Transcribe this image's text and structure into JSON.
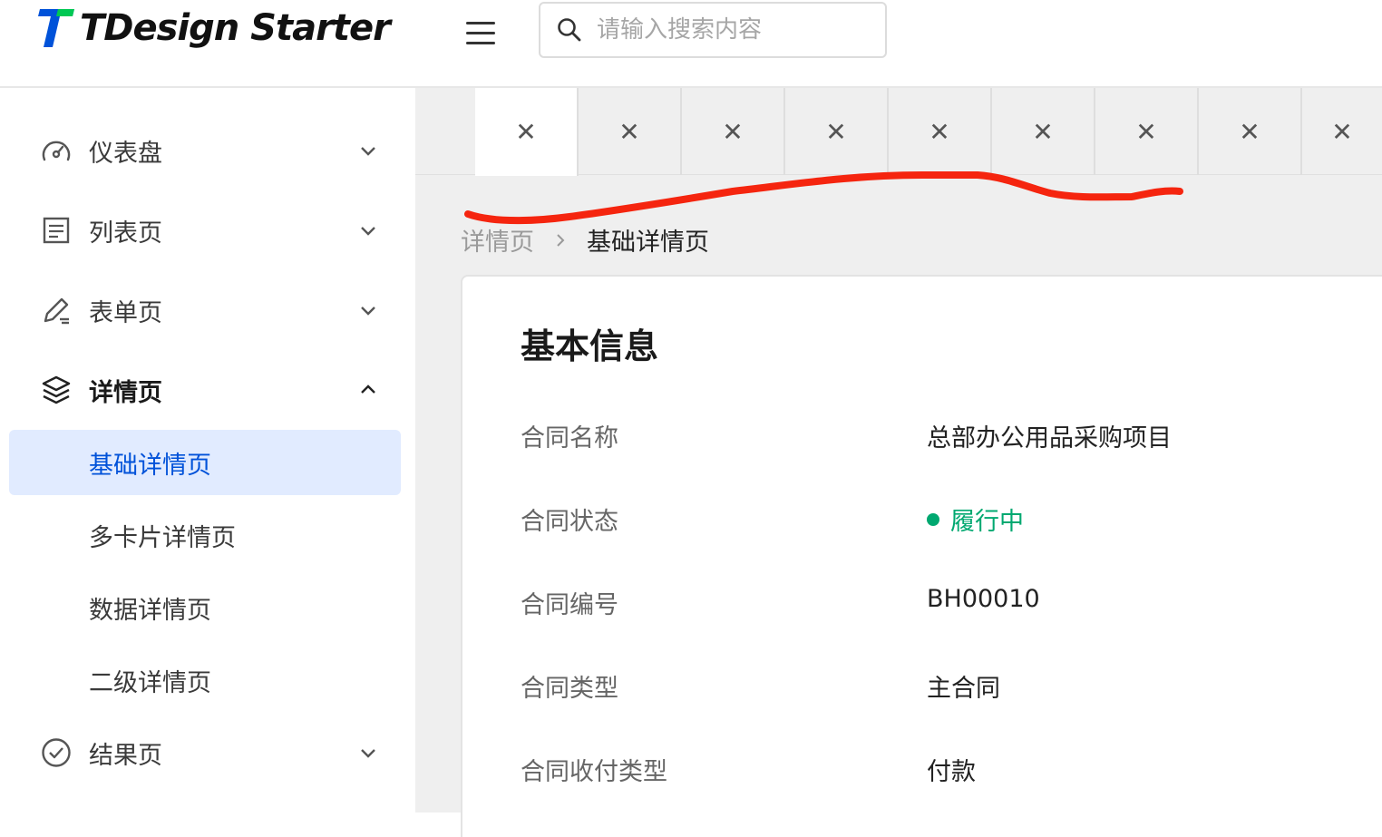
{
  "header": {
    "logo_text": "TDesign Starter",
    "search_placeholder": "请输入搜索内容"
  },
  "sidebar": {
    "items": [
      {
        "label": "仪表盘",
        "icon": "dashboard-icon",
        "expanded": false
      },
      {
        "label": "列表页",
        "icon": "list-icon",
        "expanded": false
      },
      {
        "label": "表单页",
        "icon": "edit-icon",
        "expanded": false
      },
      {
        "label": "详情页",
        "icon": "layers-icon",
        "expanded": true
      },
      {
        "label": "结果页",
        "icon": "check-circle-icon",
        "expanded": false
      }
    ],
    "sub_items": [
      {
        "label": "基础详情页",
        "active": true
      },
      {
        "label": "多卡片详情页",
        "active": false
      },
      {
        "label": "数据详情页",
        "active": false
      },
      {
        "label": "二级详情页",
        "active": false
      }
    ]
  },
  "tabs": {
    "count": 9,
    "close_glyph": "✕"
  },
  "breadcrumb": {
    "parent": "详情页",
    "current": "基础详情页"
  },
  "card": {
    "title": "基本信息",
    "rows": [
      {
        "label": "合同名称",
        "value": "总部办公用品采购项目"
      },
      {
        "label": "合同状态",
        "value": "履行中"
      },
      {
        "label": "合同编号",
        "value": "BH00010"
      },
      {
        "label": "合同类型",
        "value": "主合同"
      },
      {
        "label": "合同收付类型",
        "value": "付款"
      }
    ]
  },
  "colors": {
    "brand": "#0052d9",
    "status_success": "#00a870",
    "annotation": "#f5250f"
  }
}
